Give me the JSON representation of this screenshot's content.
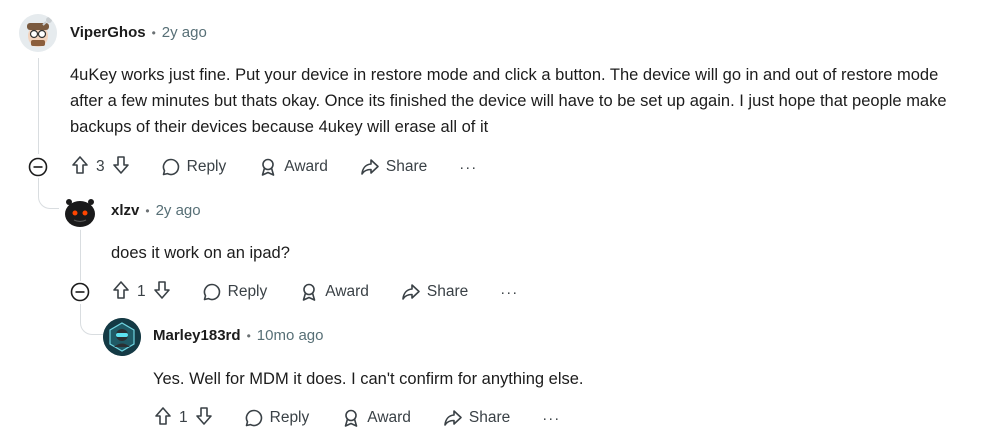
{
  "comments": [
    {
      "author": "ViperGhos",
      "time": "2y ago",
      "body": "4uKey works just fine. Put your device in restore mode and click a button. The device will go in and out of restore mode after a few minutes but thats okay. Once its finished the device will have to be set up again. I just hope that people make backups of their devices because 4ukey will erase all of it",
      "score": "3"
    },
    {
      "author": "xlzv",
      "time": "2y ago",
      "body": "does it work on an ipad?",
      "score": "1"
    },
    {
      "author": "Marley183rd",
      "time": "10mo ago",
      "body": "Yes. Well for MDM it does. I can't confirm for anything else.",
      "score": "1"
    }
  ],
  "labels": {
    "reply": "Reply",
    "award": "Award",
    "share": "Share",
    "more": "···",
    "sep": "•"
  },
  "colors": {
    "thread_line": "#d9dde0",
    "text": "#1c1c1c",
    "meta": "#576f76",
    "action": "#3a4146"
  }
}
